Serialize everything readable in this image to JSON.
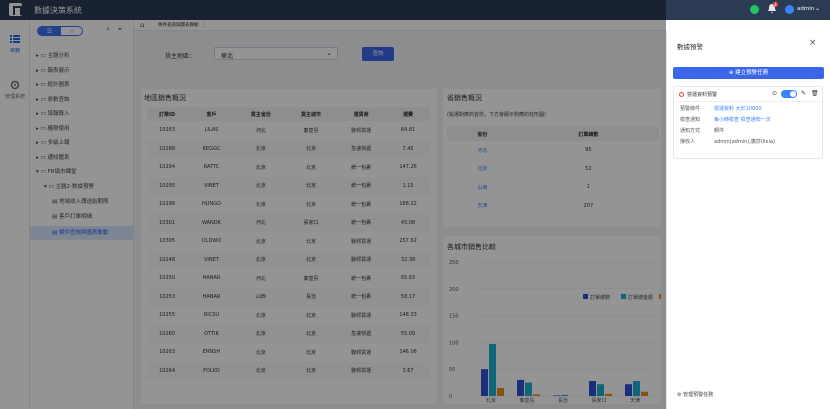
{
  "app": {
    "title": "數據決策系統",
    "user": "admin",
    "badge": "3"
  },
  "leftnav": {
    "items": [
      {
        "label": "目錄"
      },
      {
        "label": "管理系統"
      }
    ]
  },
  "tree": {
    "nodes": [
      {
        "label": "主題分析",
        "icon": "folder"
      },
      {
        "label": "報表展示",
        "icon": "folder"
      },
      {
        "label": "統計圖表",
        "icon": "folder"
      },
      {
        "label": "參數查詢",
        "icon": "folder"
      },
      {
        "label": "填報錄入",
        "icon": "folder"
      },
      {
        "label": "權限使用",
        "icon": "folder"
      },
      {
        "label": "多級上報",
        "icon": "folder"
      },
      {
        "label": "通知體系",
        "icon": "folder"
      },
      {
        "label": "FR填市課堂",
        "icon": "folder"
      },
      {
        "label": "主題2-數據預警",
        "icon": "folder"
      },
      {
        "label": "地域收入傳送給期限",
        "icon": "file"
      },
      {
        "label": "客戶訂單明細",
        "icon": "file"
      },
      {
        "label": "條件查詢與圖表聯動",
        "icon": "file"
      }
    ]
  },
  "breadcrumb": {
    "tab": "條件查詢與圖表聯動"
  },
  "filter": {
    "label": "貨主地區：",
    "value": "華北",
    "button": "查詢"
  },
  "orders": {
    "title": "地區銷售概況",
    "headers": [
      "訂單ID",
      "客戶",
      "貨主省份",
      "貨主城市",
      "運貨商",
      "運費"
    ],
    "rows": [
      [
        "10283",
        "LILAS",
        "河北",
        "秦皇島",
        "聯邦貨運",
        "84.81"
      ],
      [
        "10288",
        "REGGC",
        "北京",
        "北京",
        "急速快遞",
        "7.45"
      ],
      [
        "10294",
        "RATTC",
        "北京",
        "北京",
        "統一包裹",
        "147.26"
      ],
      [
        "10295",
        "VINET",
        "北京",
        "北京",
        "統一包裹",
        "1.15"
      ],
      [
        "10298",
        "HUNGO",
        "北京",
        "北京",
        "統一包裹",
        "168.22"
      ],
      [
        "10301",
        "WANDK",
        "河北",
        "張家口",
        "統一包裹",
        "45.08"
      ],
      [
        "10305",
        "OLDWO",
        "北京",
        "北京",
        "聯邦貨運",
        "257.62"
      ],
      [
        "10248",
        "VINET",
        "北京",
        "北京",
        "聯邦貨運",
        "32.38"
      ],
      [
        "10250",
        "HANAR",
        "河北",
        "秦皇島",
        "統一包裹",
        "65.83"
      ],
      [
        "10253",
        "HANAR",
        "山西",
        "長治",
        "統一包裹",
        "58.17"
      ],
      [
        "10255",
        "RICSU",
        "北京",
        "北京",
        "聯邦貨運",
        "148.33"
      ],
      [
        "10260",
        "OTTIK",
        "北京",
        "北京",
        "急速快遞",
        "55.09"
      ],
      [
        "10263",
        "ERNSH",
        "北京",
        "北京",
        "聯邦貨運",
        "146.06"
      ],
      [
        "10264",
        "FOLKO",
        "北京",
        "北京",
        "聯邦貨運",
        "3.67"
      ]
    ]
  },
  "province": {
    "title": "省銷售概況",
    "note": "(點選對應的省份，下方會顯示對應的柱形圖)",
    "headers": [
      "省份",
      "訂單總數"
    ],
    "rows": [
      [
        "河北",
        "95"
      ],
      [
        "北京",
        "52"
      ],
      [
        "山西",
        "1"
      ],
      [
        "天津",
        "207"
      ]
    ]
  },
  "chart_data": {
    "type": "bar",
    "title": "各城市銷售比較",
    "categories": [
      "北京",
      "秦皇島",
      "長治",
      "張家口",
      "天津"
    ],
    "series": [
      {
        "name": "訂單總數",
        "values": [
          50,
          30,
          1,
          28,
          22
        ],
        "color": "#2f4fd8"
      },
      {
        "name": "訂單總金額",
        "values": [
          97,
          25,
          2,
          22,
          28
        ],
        "color": "#1cb0d0"
      },
      {
        "name": "運費",
        "values": [
          15,
          3,
          0,
          4,
          8
        ],
        "color": "#f08a1c"
      }
    ],
    "ylim": [
      0,
      250
    ],
    "yticks": [
      "250",
      "200",
      "150",
      "100",
      "50",
      "0"
    ],
    "grid": true,
    "legend": "top-right"
  },
  "drawer": {
    "title": "數據預警",
    "new_button": "建立預警任務",
    "rule": {
      "name": "營運資料預警",
      "rows": [
        [
          "預警條件",
          "營運資料 大於10000"
        ],
        [
          "檢查通知",
          "每小時檢查 檢查通知一次"
        ],
        [
          "通知方式",
          "郵件"
        ],
        [
          "接收人",
          "admin(admin),廣莎(lixia)"
        ]
      ]
    },
    "footer": "管理預警任務"
  }
}
